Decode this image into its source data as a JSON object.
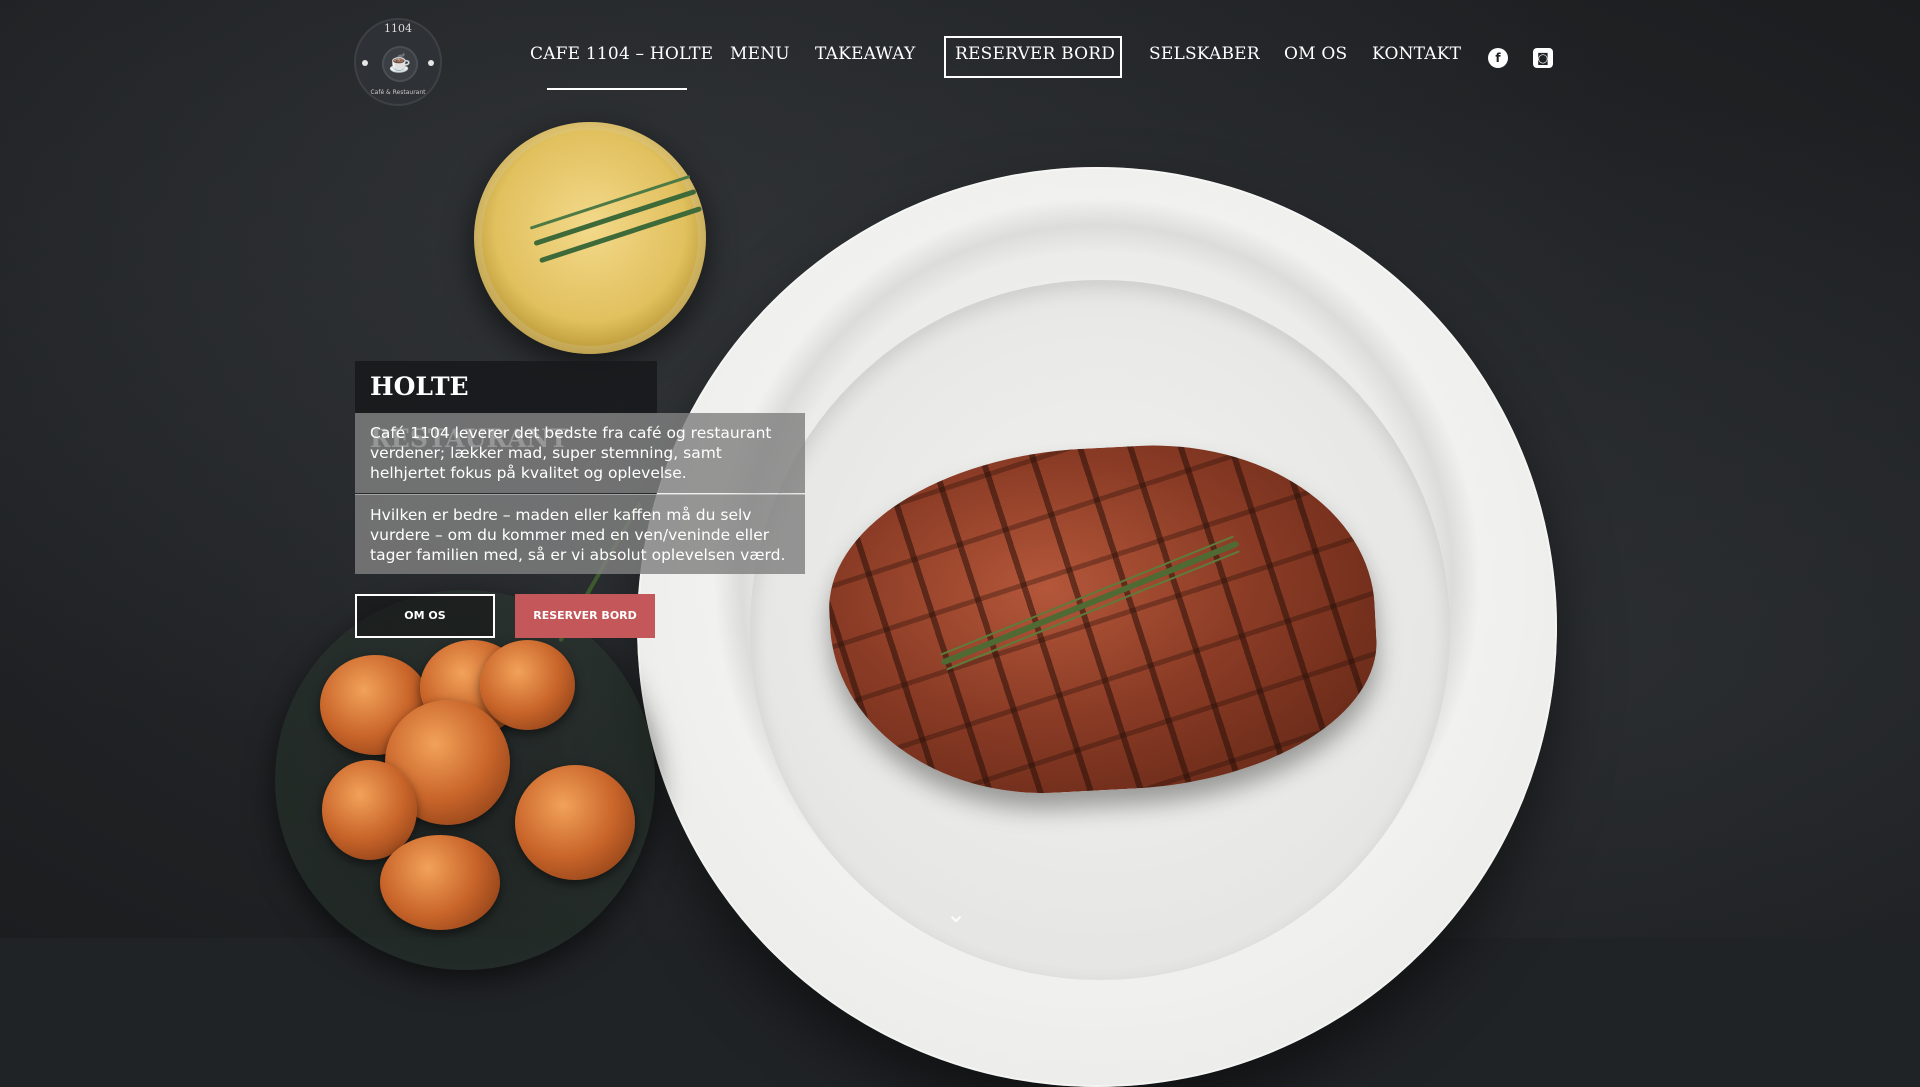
{
  "logo": {
    "number": "1104",
    "subtitle": "Café & Restaurant",
    "cup_glyph": "☕"
  },
  "nav": {
    "items": [
      {
        "label": "CAFE 1104 – HOLTE",
        "active": true
      },
      {
        "label": "MENU"
      },
      {
        "label": "TAKEAWAY"
      },
      {
        "label": "RESERVER BORD",
        "boxed": true
      },
      {
        "label": "SELSKABER"
      },
      {
        "label": "OM OS"
      },
      {
        "label": "KONTAKT"
      }
    ],
    "social": [
      {
        "name": "facebook-icon",
        "glyph": "f"
      },
      {
        "name": "instagram-icon",
        "glyph": "◙"
      }
    ]
  },
  "hero": {
    "title": "HOLTE RESTAURANT",
    "paragraphs": [
      "Café 1104 leverer det bedste fra café og restaurant verdener; lækker mad, super stemning, samt helhjertet fokus på kvalitet og oplevelse.",
      "Hvilken er bedre – maden eller kaffen må du selv vurdere – om du kommer med en ven/veninde eller tager familien med, så er vi absolut oplevelsen værd."
    ],
    "buttons": {
      "om_os": "OM OS",
      "reserver": "RESERVER BORD"
    },
    "scroll_glyph": "⌄"
  },
  "colors": {
    "accent_button": "#c4575a",
    "background": "#202326"
  }
}
